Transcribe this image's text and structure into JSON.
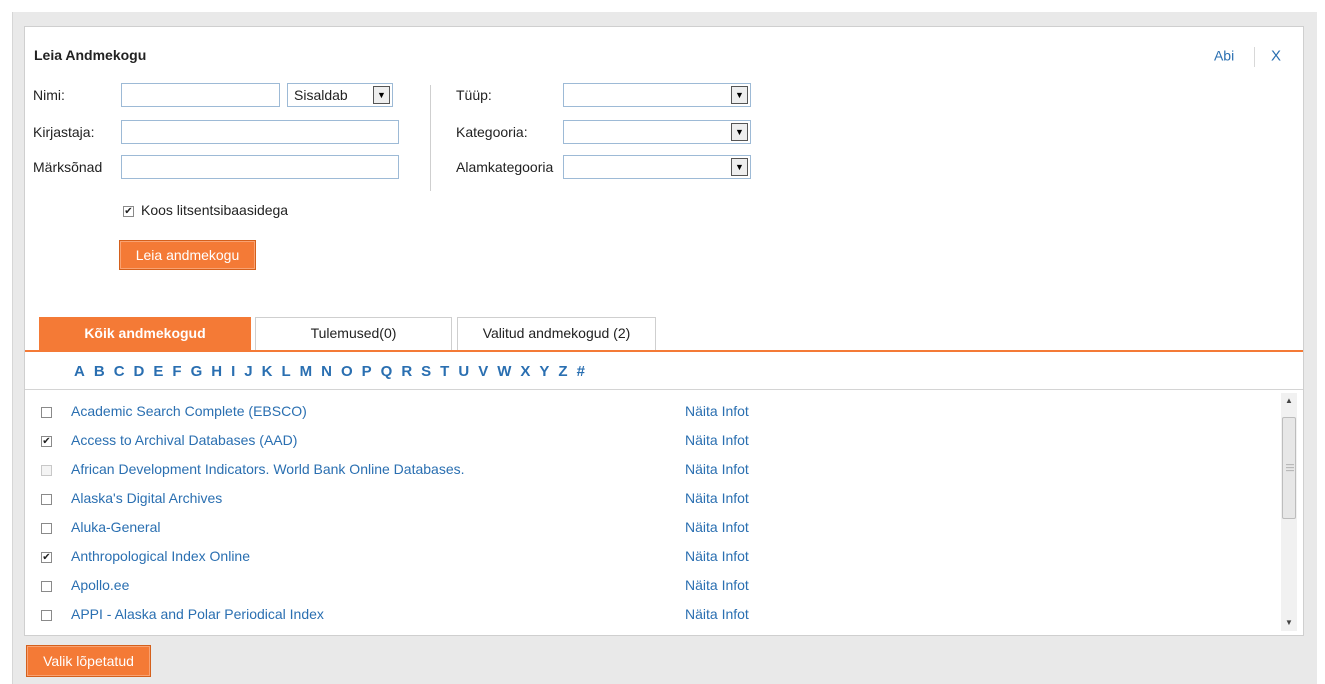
{
  "dialog": {
    "title": "Leia Andmekogu",
    "help_label": "Abi",
    "close_label": "X"
  },
  "form": {
    "name_label": "Nimi:",
    "name_value": "",
    "match_select": "Sisaldab",
    "author_label": "Kirjastaja:",
    "author_value": "",
    "keywords_label": "Märksõnad",
    "keywords_value": "",
    "type_label": "Tüüp:",
    "type_value": "",
    "category_label": "Kategooria:",
    "category_value": "",
    "subcategory_label": "Alamkategooria",
    "subcategory_value": "",
    "licensed_checkbox_label": "Koos litsentsibaasidega",
    "licensed_checked": true,
    "search_button": "Leia andmekogu"
  },
  "tabs": [
    {
      "label": "Kõik andmekogud",
      "active": true
    },
    {
      "label": "Tulemused(0)",
      "active": false
    },
    {
      "label": "Valitud andmekogud (2)",
      "active": false
    }
  ],
  "alphabet": [
    "A",
    "B",
    "C",
    "D",
    "E",
    "F",
    "G",
    "H",
    "I",
    "J",
    "K",
    "L",
    "M",
    "N",
    "O",
    "P",
    "Q",
    "R",
    "S",
    "T",
    "U",
    "V",
    "W",
    "X",
    "Y",
    "Z",
    "#"
  ],
  "info_label": "Näita Infot",
  "databases": [
    {
      "name": "Academic Search Complete (EBSCO)",
      "checked": false,
      "disabled": false
    },
    {
      "name": "Access to Archival Databases (AAD)",
      "checked": true,
      "disabled": false
    },
    {
      "name": "African Development Indicators. World Bank Online Databases.",
      "checked": false,
      "disabled": true
    },
    {
      "name": "Alaska's Digital Archives",
      "checked": false,
      "disabled": false
    },
    {
      "name": "Aluka-General",
      "checked": false,
      "disabled": false
    },
    {
      "name": "Anthropological Index Online",
      "checked": true,
      "disabled": false
    },
    {
      "name": "Apollo.ee",
      "checked": false,
      "disabled": false
    },
    {
      "name": "APPI - Alaska and Polar Periodical Index",
      "checked": false,
      "disabled": false
    }
  ],
  "footer": {
    "done_button": "Valik lõpetatud"
  },
  "colors": {
    "accent": "#f47a36",
    "link": "#2a6fb1"
  }
}
